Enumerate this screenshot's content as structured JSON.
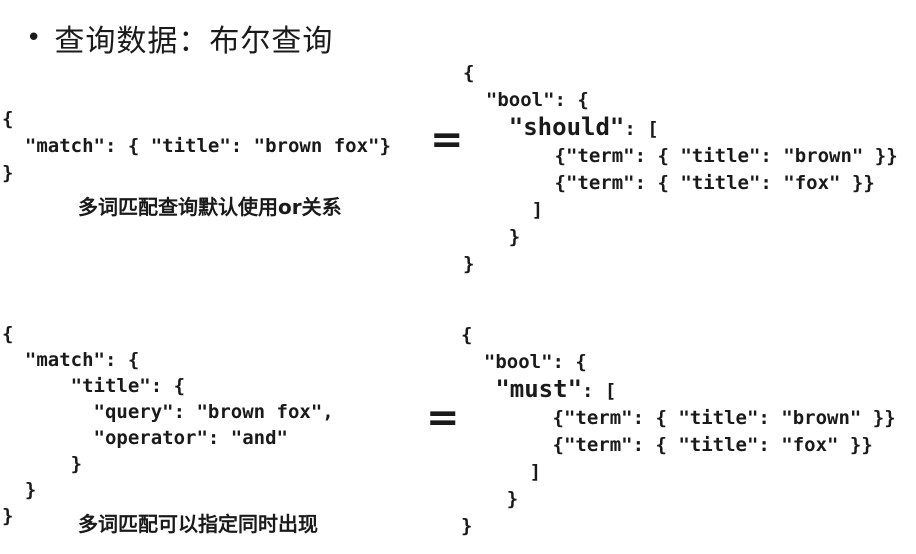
{
  "heading": {
    "bullet": "•",
    "text": "查询数据：布尔查询"
  },
  "example1": {
    "match_query": [
      "{",
      "  \"match\": { \"title\": \"brown fox\"}",
      "}"
    ],
    "equals": "=",
    "bool_query": {
      "open": "{",
      "bool_line": "  \"bool\": {",
      "clause_indent": "    ",
      "clause_keyword": "\"should\"",
      "clause_rest": ": [",
      "term1": "        {\"term\": { \"title\": \"brown\" }}",
      "term2": "        {\"term\": { \"title\": \"fox\" }}",
      "close_bracket": "      ]",
      "close_bool": "    }",
      "close": "}"
    },
    "caption": "多词匹配查询默认使用or关系"
  },
  "example2": {
    "match_query": [
      "{",
      "  \"match\": {",
      "      \"title\": {",
      "        \"query\": \"brown fox\",",
      "        \"operator\": \"and\"",
      "      }",
      "  }",
      "}"
    ],
    "equals": "=",
    "bool_query": {
      "open": "{",
      "bool_line": "  \"bool\": {",
      "clause_indent": "   ",
      "clause_keyword": "\"must\"",
      "clause_rest": ": [",
      "term1": "        {\"term\": { \"title\": \"brown\" }}",
      "term2": "        {\"term\": { \"title\": \"fox\" }}",
      "close_bracket": "      ]",
      "close_bool": "    }",
      "close": "}"
    },
    "caption": "多词匹配可以指定同时出现"
  }
}
